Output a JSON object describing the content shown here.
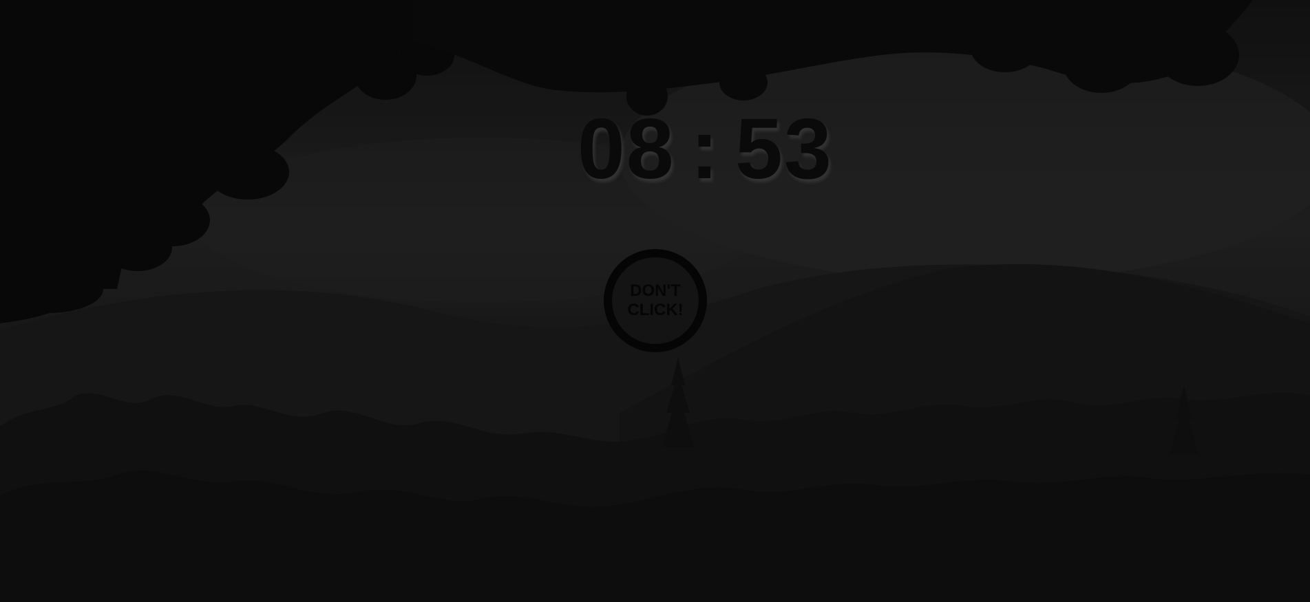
{
  "timer": {
    "minutes": "08",
    "separator": ":",
    "seconds": "53"
  },
  "center_button": {
    "label": "DON'T\nCLICK!"
  },
  "colors": {
    "overlay": "#000000",
    "text": "#0a0a0a",
    "button_ring": "#050505"
  },
  "background": {
    "description_icon": "forest-landscape"
  }
}
